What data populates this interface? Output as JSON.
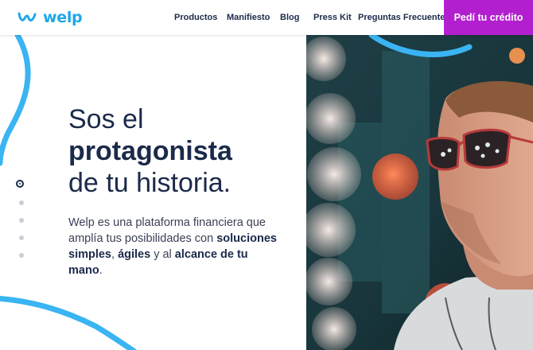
{
  "header": {
    "logo_text": "welp",
    "nav": [
      "Productos",
      "Manifiesto",
      "Blog",
      "Press Kit",
      "Preguntas Frecuentes"
    ],
    "cta": "Pedí tu crédito"
  },
  "hero": {
    "headline_line1": "Sos el",
    "headline_line2": "protagonista",
    "headline_line3": "de tu historia.",
    "sub_1": "Welp es una plataforma financiera que amplía tus posibilidades con ",
    "sub_b1": "soluciones simples",
    "sub_2": ", ",
    "sub_b2": "ágiles",
    "sub_3": " y al ",
    "sub_b3": "alcance de tu mano",
    "sub_4": "."
  },
  "slider": {
    "count": 5,
    "active_index": 0
  },
  "colors": {
    "brand_blue": "#1fa7e8",
    "navy": "#1b2a4a",
    "cta_purple": "#b21fcf"
  },
  "icons": [
    "welp-logo-icon",
    "slide-dot-icon"
  ]
}
